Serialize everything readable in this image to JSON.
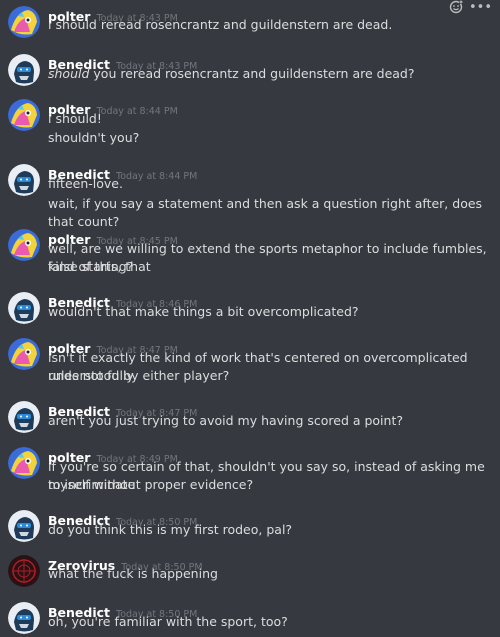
{
  "toolbar": {
    "reaction_icon": "add-reaction-icon",
    "more_icon": "more-options-icon",
    "more_label": "•••"
  },
  "messages": [
    {
      "author": "polter",
      "timestamp": "Today at 8:43 PM",
      "avatar_icon": "avatar-polter",
      "lines": [
        "i should reread rosencrantz and guildenstern are dead."
      ]
    },
    {
      "author": "Benedict",
      "timestamp": "Today at 8:43 PM",
      "avatar_icon": "avatar-benedict",
      "lines": [
        "should you reread rosencrantz and guildenstern are dead?"
      ]
    },
    {
      "author": "polter",
      "timestamp": "Today at 8:44 PM",
      "avatar_icon": "avatar-polter",
      "lines": [
        "i should!",
        "shouldn't you?"
      ]
    },
    {
      "author": "Benedict",
      "timestamp": "Today at 8:44 PM",
      "avatar_icon": "avatar-benedict",
      "lines": [
        "fifteen-love.",
        "wait, if you say a statement and then ask a question right after, does that count?"
      ]
    },
    {
      "author": "polter",
      "timestamp": "Today at 8:45 PM",
      "avatar_icon": "avatar-polter",
      "lines": [
        "well, are we willing to extend the sports metaphor to include fumbles, false starts, that",
        "kind of thing?"
      ]
    },
    {
      "author": "Benedict",
      "timestamp": "Today at 8:46 PM",
      "avatar_icon": "avatar-benedict",
      "lines": [
        "wouldn't that make things a bit overcomplicated?"
      ]
    },
    {
      "author": "polter",
      "timestamp": "Today at 8:47 PM",
      "avatar_icon": "avatar-polter",
      "lines": [
        "isn't it exactly the kind of work that's centered on overcomplicated rules not fully",
        "understood by either player?"
      ]
    },
    {
      "author": "Benedict",
      "timestamp": "Today at 8:47 PM",
      "avatar_icon": "avatar-benedict",
      "lines": [
        "aren't you just trying to avoid my having scored a point?"
      ]
    },
    {
      "author": "polter",
      "timestamp": "Today at 8:49 PM",
      "avatar_icon": "avatar-polter",
      "lines": [
        "if you're so certain of that, shouldn't you say so, instead of asking me to incriminate",
        "myself without proper evidence?"
      ]
    },
    {
      "author": "Benedict",
      "timestamp": "Today at 8:50 PM",
      "avatar_icon": "avatar-benedict",
      "lines": [
        "do you think this is my first rodeo, pal?"
      ]
    },
    {
      "author": "Zerovirus",
      "timestamp": "Today at 8:50 PM",
      "avatar_icon": "avatar-zerovirus",
      "lines": [
        "what the fuck is happening"
      ]
    },
    {
      "author": "Benedict",
      "timestamp": "Today at 8:50 PM",
      "avatar_icon": "avatar-benedict",
      "lines": [
        "oh, you're familiar with the sport, too?"
      ]
    }
  ]
}
